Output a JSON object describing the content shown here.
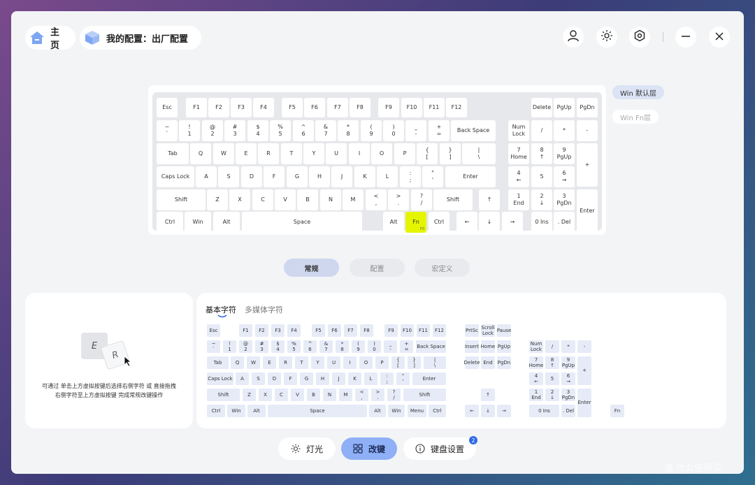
{
  "header": {
    "home_label": "主页",
    "profile_label": "我的配置：出厂配置"
  },
  "colors": {
    "accent": "#8fb0f6",
    "fn_key": "#e5f500",
    "badge": "#2f6ae6"
  },
  "icons": [
    "home-icon",
    "cube-icon",
    "user-icon",
    "sun-icon",
    "settings-icon",
    "minimize-icon",
    "close-icon",
    "light-icon",
    "grid-icon",
    "info-icon",
    "cursor-icon"
  ],
  "layers": {
    "win_default": "Win 默认层",
    "win_fn": "Win Fn层"
  },
  "tabs": [
    "常规",
    "配置",
    "宏定义"
  ],
  "main_keys": [
    {
      "id": "esc",
      "l": "Esc"
    },
    {
      "id": "f1",
      "l": "F1"
    },
    {
      "id": "f2",
      "l": "F2"
    },
    {
      "id": "f3",
      "l": "F3"
    },
    {
      "id": "f4",
      "l": "F4"
    },
    {
      "id": "f5",
      "l": "F5"
    },
    {
      "id": "f6",
      "l": "F6"
    },
    {
      "id": "f7",
      "l": "F7"
    },
    {
      "id": "f8",
      "l": "F8"
    },
    {
      "id": "f9",
      "l": "F9"
    },
    {
      "id": "f10",
      "l": "F10"
    },
    {
      "id": "f11",
      "l": "F11"
    },
    {
      "id": "f12",
      "l": "F12"
    },
    {
      "id": "delete",
      "l": "Delete"
    },
    {
      "id": "pgup",
      "l": "PgUp"
    },
    {
      "id": "pgdn",
      "l": "PgDn"
    },
    {
      "id": "grave",
      "l": "~\n`"
    },
    {
      "id": "1",
      "l": "!\n1"
    },
    {
      "id": "2",
      "l": "@\n2"
    },
    {
      "id": "3",
      "l": "#\n3"
    },
    {
      "id": "4",
      "l": "$\n4"
    },
    {
      "id": "5",
      "l": "%\n5"
    },
    {
      "id": "6",
      "l": "^\n6"
    },
    {
      "id": "7",
      "l": "&\n7"
    },
    {
      "id": "8",
      "l": "*\n8"
    },
    {
      "id": "9",
      "l": "(\n9"
    },
    {
      "id": "0",
      "l": ")\n0"
    },
    {
      "id": "minus",
      "l": "_\n-"
    },
    {
      "id": "equal",
      "l": "+\n="
    },
    {
      "id": "backspace",
      "l": "Back Space"
    },
    {
      "id": "numlock",
      "l": "Num\nLock"
    },
    {
      "id": "num-slash",
      "l": "/"
    },
    {
      "id": "num-star",
      "l": "*"
    },
    {
      "id": "num-minus",
      "l": "-"
    },
    {
      "id": "tab",
      "l": "Tab"
    },
    {
      "id": "q",
      "l": "Q"
    },
    {
      "id": "w",
      "l": "W"
    },
    {
      "id": "e",
      "l": "E"
    },
    {
      "id": "r",
      "l": "R"
    },
    {
      "id": "t",
      "l": "T"
    },
    {
      "id": "y",
      "l": "Y"
    },
    {
      "id": "u",
      "l": "U"
    },
    {
      "id": "i",
      "l": "I"
    },
    {
      "id": "o",
      "l": "O"
    },
    {
      "id": "p",
      "l": "P"
    },
    {
      "id": "lbracket",
      "l": "{\n["
    },
    {
      "id": "rbracket",
      "l": "}\n]"
    },
    {
      "id": "backslash",
      "l": "|\n\\"
    },
    {
      "id": "num7",
      "l": "7\nHome"
    },
    {
      "id": "num8",
      "l": "8\n↑"
    },
    {
      "id": "num9",
      "l": "9\nPgUp"
    },
    {
      "id": "num-plus",
      "l": "+"
    },
    {
      "id": "capslock",
      "l": "Caps Lock"
    },
    {
      "id": "a",
      "l": "A"
    },
    {
      "id": "s",
      "l": "S"
    },
    {
      "id": "d",
      "l": "D"
    },
    {
      "id": "f",
      "l": "F"
    },
    {
      "id": "g",
      "l": "G"
    },
    {
      "id": "h",
      "l": "H"
    },
    {
      "id": "j",
      "l": "J"
    },
    {
      "id": "k",
      "l": "K"
    },
    {
      "id": "l",
      "l": "L"
    },
    {
      "id": "semicolon",
      "l": ":\n;"
    },
    {
      "id": "quote",
      "l": "\"\n'"
    },
    {
      "id": "enter",
      "l": "Enter"
    },
    {
      "id": "num4",
      "l": "4\n←"
    },
    {
      "id": "num5",
      "l": "5"
    },
    {
      "id": "num6",
      "l": "6\n→"
    },
    {
      "id": "lshift",
      "l": "Shift"
    },
    {
      "id": "z",
      "l": "Z"
    },
    {
      "id": "x",
      "l": "X"
    },
    {
      "id": "c",
      "l": "C"
    },
    {
      "id": "v",
      "l": "V"
    },
    {
      "id": "b",
      "l": "B"
    },
    {
      "id": "n",
      "l": "N"
    },
    {
      "id": "m",
      "l": "M"
    },
    {
      "id": "comma",
      "l": "<\n,"
    },
    {
      "id": "period",
      "l": ">\n."
    },
    {
      "id": "slash",
      "l": "?\n/"
    },
    {
      "id": "rshift",
      "l": "Shift"
    },
    {
      "id": "up",
      "l": "↑"
    },
    {
      "id": "num1",
      "l": "1\nEnd"
    },
    {
      "id": "num2",
      "l": "2\n↓"
    },
    {
      "id": "num3",
      "l": "3\nPgDn"
    },
    {
      "id": "num-enter",
      "l": "Enter"
    },
    {
      "id": "lctrl",
      "l": "Ctrl"
    },
    {
      "id": "lwin",
      "l": "Win"
    },
    {
      "id": "lalt",
      "l": "Alt"
    },
    {
      "id": "space",
      "l": "Space"
    },
    {
      "id": "ralt",
      "l": "Alt"
    },
    {
      "id": "fn",
      "l": "Fn",
      "sub": "F0"
    },
    {
      "id": "rctrl",
      "l": "Ctrl"
    },
    {
      "id": "left",
      "l": "←"
    },
    {
      "id": "down",
      "l": "↓"
    },
    {
      "id": "right",
      "l": "→"
    },
    {
      "id": "num0",
      "l": "0 Ins"
    },
    {
      "id": "num-del",
      "l": ". Del"
    }
  ],
  "sub_tabs": {
    "basic": "基本字符",
    "media": "多媒体字符"
  },
  "instruction": "可通过 单击上方虚拟按键后选择右侧字符 或 直接拖拽\n右侧字符至上方虚拟按键 完成常规改键操作",
  "illustration": {
    "key_e": "E",
    "key_r": "R"
  },
  "picker_keys": [
    {
      "id": "esc",
      "l": "Esc"
    },
    {
      "id": "f1",
      "l": "F1"
    },
    {
      "id": "f2",
      "l": "F2"
    },
    {
      "id": "f3",
      "l": "F3"
    },
    {
      "id": "f4",
      "l": "F4"
    },
    {
      "id": "f5",
      "l": "F5"
    },
    {
      "id": "f6",
      "l": "F6"
    },
    {
      "id": "f7",
      "l": "F7"
    },
    {
      "id": "f8",
      "l": "F8"
    },
    {
      "id": "f9",
      "l": "F9"
    },
    {
      "id": "f10",
      "l": "F10"
    },
    {
      "id": "f11",
      "l": "F11"
    },
    {
      "id": "f12",
      "l": "F12"
    },
    {
      "id": "prtsc",
      "l": "PrtSc"
    },
    {
      "id": "scrolllock",
      "l": "Scroll\nLock"
    },
    {
      "id": "pause",
      "l": "Pause"
    },
    {
      "id": "grave",
      "l": "~\n`"
    },
    {
      "id": "1",
      "l": "!\n1"
    },
    {
      "id": "2",
      "l": "@\n2"
    },
    {
      "id": "3",
      "l": "#\n3"
    },
    {
      "id": "4",
      "l": "$\n4"
    },
    {
      "id": "5",
      "l": "%\n5"
    },
    {
      "id": "6",
      "l": "^\n6"
    },
    {
      "id": "7",
      "l": "&\n7"
    },
    {
      "id": "8",
      "l": "*\n8"
    },
    {
      "id": "9",
      "l": "(\n9"
    },
    {
      "id": "0",
      "l": ")\n0"
    },
    {
      "id": "minus",
      "l": "_\n-"
    },
    {
      "id": "equal",
      "l": "+\n="
    },
    {
      "id": "backspace",
      "l": "Back Space"
    },
    {
      "id": "insert",
      "l": "Insert"
    },
    {
      "id": "home",
      "l": "Home"
    },
    {
      "id": "pgup",
      "l": "PgUp"
    },
    {
      "id": "numlock",
      "l": "Num\nLock"
    },
    {
      "id": "num-slash",
      "l": "/"
    },
    {
      "id": "num-star",
      "l": "*"
    },
    {
      "id": "num-minus",
      "l": "-"
    },
    {
      "id": "tab",
      "l": "Tab"
    },
    {
      "id": "q",
      "l": "Q"
    },
    {
      "id": "w",
      "l": "W"
    },
    {
      "id": "e",
      "l": "E"
    },
    {
      "id": "r",
      "l": "R"
    },
    {
      "id": "t",
      "l": "T"
    },
    {
      "id": "y",
      "l": "Y"
    },
    {
      "id": "u",
      "l": "U"
    },
    {
      "id": "i",
      "l": "I"
    },
    {
      "id": "o",
      "l": "O"
    },
    {
      "id": "p",
      "l": "P"
    },
    {
      "id": "lbracket",
      "l": "{\n["
    },
    {
      "id": "rbracket",
      "l": "}\n]"
    },
    {
      "id": "backslash",
      "l": "|\n\\"
    },
    {
      "id": "delete",
      "l": "Delete"
    },
    {
      "id": "end",
      "l": "End"
    },
    {
      "id": "pgdn",
      "l": "PgDn"
    },
    {
      "id": "num7",
      "l": "7\nHome"
    },
    {
      "id": "num8",
      "l": "8\n↑"
    },
    {
      "id": "num9",
      "l": "9\nPgUp"
    },
    {
      "id": "num-plus",
      "l": "+"
    },
    {
      "id": "capslock",
      "l": "Caps Lock"
    },
    {
      "id": "a",
      "l": "A"
    },
    {
      "id": "s",
      "l": "S"
    },
    {
      "id": "d",
      "l": "D"
    },
    {
      "id": "f",
      "l": "F"
    },
    {
      "id": "g",
      "l": "G"
    },
    {
      "id": "h",
      "l": "H"
    },
    {
      "id": "j",
      "l": "J"
    },
    {
      "id": "k",
      "l": "K"
    },
    {
      "id": "l",
      "l": "L"
    },
    {
      "id": "semicolon",
      "l": ":\n;"
    },
    {
      "id": "quote",
      "l": "\"\n'"
    },
    {
      "id": "enter",
      "l": "Enter"
    },
    {
      "id": "num4",
      "l": "4\n←"
    },
    {
      "id": "num5",
      "l": "5"
    },
    {
      "id": "num6",
      "l": "6\n→"
    },
    {
      "id": "lshift",
      "l": "Shift"
    },
    {
      "id": "z",
      "l": "Z"
    },
    {
      "id": "x",
      "l": "X"
    },
    {
      "id": "c",
      "l": "C"
    },
    {
      "id": "v",
      "l": "V"
    },
    {
      "id": "b",
      "l": "B"
    },
    {
      "id": "n",
      "l": "N"
    },
    {
      "id": "m",
      "l": "M"
    },
    {
      "id": "comma",
      "l": "<\n,"
    },
    {
      "id": "period",
      "l": ">\n."
    },
    {
      "id": "slash",
      "l": "?\n/"
    },
    {
      "id": "rshift",
      "l": "Shift"
    },
    {
      "id": "up",
      "l": "↑"
    },
    {
      "id": "num1",
      "l": "1\nEnd"
    },
    {
      "id": "num2",
      "l": "2\n↓"
    },
    {
      "id": "num3",
      "l": "3\nPgDn"
    },
    {
      "id": "num-enter",
      "l": "Enter"
    },
    {
      "id": "lctrl",
      "l": "Ctrl"
    },
    {
      "id": "lwin",
      "l": "Win"
    },
    {
      "id": "lalt",
      "l": "Alt"
    },
    {
      "id": "space",
      "l": "Space"
    },
    {
      "id": "ralt",
      "l": "Alt"
    },
    {
      "id": "rwin",
      "l": "Win"
    },
    {
      "id": "menu",
      "l": "Menu"
    },
    {
      "id": "rctrl",
      "l": "Ctrl"
    },
    {
      "id": "left",
      "l": "←"
    },
    {
      "id": "down",
      "l": "↓"
    },
    {
      "id": "right",
      "l": "→"
    },
    {
      "id": "num0",
      "l": "0 Ins"
    },
    {
      "id": "num-del",
      "l": ". Del"
    },
    {
      "id": "fn",
      "l": "Fn"
    }
  ],
  "bottom_nav": {
    "light": "灯光",
    "remap": "改键",
    "settings": "键盘设置",
    "settings_badge": "2"
  },
  "watermark": "值 什么值得买"
}
